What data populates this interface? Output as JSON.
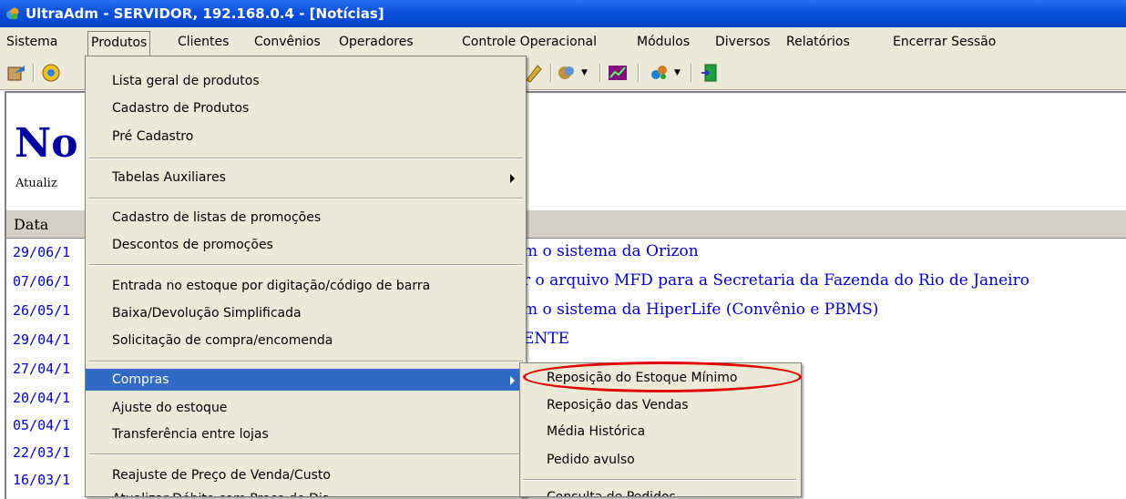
{
  "window": {
    "title": "UltraAdm - SERVIDOR, 192.168.0.4 - [Notícias]"
  },
  "menubar": {
    "items": [
      "Sistema",
      "Produtos",
      "Clientes",
      "Convênios",
      "Operadores",
      "Controle Operacional",
      "Módulos",
      "Diversos",
      "Relatórios",
      "Encerrar Sessão"
    ],
    "open_menu": "Produtos"
  },
  "toolbar": {
    "icons": [
      "exit-icon",
      "globe-icon",
      "palette-icon",
      "shield-icon",
      "chart-icon",
      "network-icon",
      "door-icon"
    ]
  },
  "page": {
    "title": "No",
    "updated_label": "Atualiz",
    "column_header": "Data"
  },
  "news": [
    {
      "date": "29/06/1",
      "title": "m o sistema da Orizon"
    },
    {
      "date": "07/06/1",
      "title": "r o arquivo MFD para a Secretaria da Fazenda do Rio de Janeiro"
    },
    {
      "date": "26/05/1",
      "title": "m o sistema da HiperLife (Convênio e PBMS)"
    },
    {
      "date": "29/04/1",
      "title": "ENTE"
    },
    {
      "date": "27/04/1",
      "title": ""
    },
    {
      "date": "20/04/1",
      "title": ""
    },
    {
      "date": "05/04/1",
      "title": ""
    },
    {
      "date": "22/03/1",
      "title": ""
    },
    {
      "date": "16/03/1",
      "title": ""
    }
  ],
  "produtos_menu": {
    "items": [
      "Lista geral de produtos",
      "Cadastro de Produtos",
      "Pré Cadastro",
      "Tabelas Auxiliares",
      "Cadastro de listas de promoções",
      "Descontos de promoções",
      "Entrada no estoque por digitação/código de barra",
      "Baixa/Devolução Simplificada",
      "Solicitação de compra/encomenda",
      "Compras",
      "Ajuste do estoque",
      "Transferência entre lojas",
      "Reajuste de Preço de Venda/Custo",
      "Atualizar Débito com Preço do Dia"
    ],
    "highlighted": "Compras"
  },
  "compras_submenu": {
    "items": [
      "Reposição do Estoque Mínimo",
      "Reposição das Vendas",
      "Média Histórica",
      "Pedido avulso",
      "Consulta de Pedidos"
    ],
    "circled": "Reposição do Estoque Mínimo"
  },
  "colors": {
    "title_bar": "#0a4fd9",
    "menu_bg": "#ece9d8",
    "highlight": "#316ac5",
    "link_blue": "#0000cc",
    "heading_blue": "#0000a0",
    "annotation_red": "#e00000"
  }
}
